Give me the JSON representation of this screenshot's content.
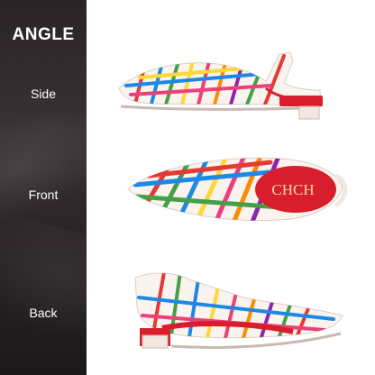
{
  "sidebar": {
    "title": "ANGLE",
    "labels": [
      "Side",
      "Front",
      "Back"
    ]
  },
  "insole_brand": "CHCH",
  "colors": {
    "sidebar_dark": "#2a2426",
    "insole_red": "#d81e2c",
    "stripe_colors": [
      "#e53935",
      "#fb8c00",
      "#fdd835",
      "#43a047",
      "#1e88e5",
      "#ec407a",
      "#8e24aa"
    ]
  },
  "icons": [
    "side-view-shoe",
    "front-view-shoe",
    "back-view-shoe"
  ]
}
